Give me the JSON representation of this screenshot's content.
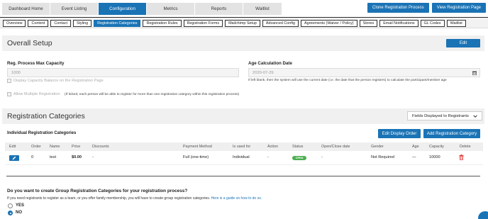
{
  "main_tabs": [
    "Dashboard Home",
    "Event Listing",
    "Configuration",
    "Metrics",
    "Reports",
    "Waitlist"
  ],
  "top_actions": {
    "clone": "Clone Registration Process",
    "view": "View Registration Page"
  },
  "sub_tabs": [
    "Overview",
    "Content",
    "Contact",
    "Styling",
    "Registration Categories",
    "Registration Rules",
    "Registration Forms",
    "Mailchimp Setup",
    "Advanced Config",
    "Agreements (Waiver / Policy)",
    "Stores",
    "Email Notifications",
    "GL Codes",
    "Waitlist"
  ],
  "overall_setup": {
    "title": "Overall Setup",
    "edit_label": "Edit",
    "max_capacity_label": "Reg. Process Max Capacity",
    "max_capacity_value": "1000",
    "display_capacity_label": "Display Capacity Balance on the Registration Page",
    "allow_multiple_label": "Allow Multiple Registration",
    "allow_multiple_note": "(If ticked, each person will be able to register for more than one registration category within this registration process)",
    "age_calc_label": "Age Calculation Date",
    "age_calc_value": "2020-07-29",
    "age_calc_note": "If left blank, then the system will use the current date (i.e. the date that the person registers) to calculate the participant/member age"
  },
  "registration_categories": {
    "title": "Registration Categories",
    "filter_label": "Fields Displayed to Registrants",
    "individual_title": "Individual Registration Categories",
    "edit_display_order": "Edit Display Order",
    "add_category": "Add Registration Category",
    "columns": [
      "Edit",
      "Order",
      "Name",
      "Price",
      "Discounts",
      "Payment Method",
      "Is used for",
      "Action",
      "Status",
      "Open/Close date",
      "Gender",
      "Age",
      "Capacity",
      "Delete"
    ],
    "rows": [
      {
        "order": "0",
        "name": "test",
        "price": "$0.00",
        "discounts": "-",
        "payment_method": "Full (one-time)",
        "used_for": "Individual",
        "action": "-",
        "status": "OPEN",
        "open_close": "-",
        "gender": "Not Required",
        "age": "—",
        "capacity": "10000"
      }
    ]
  },
  "group_section": {
    "question": "Do you want to create Group Registration Categories for your registration process?",
    "help_text": "If you need registrants to register as a team, or you offer family membership, you will have to create group registration categories.",
    "guide_link": "Here is a guide on how to do so.",
    "yes_label": "YES",
    "no_label": "NO",
    "selected": "NO"
  },
  "colors": {
    "accent": "#1a73b5",
    "status_open": "#4caf50",
    "delete": "#e53935"
  },
  "icons": {
    "edit": "pencil-icon",
    "calendar": "calendar-icon",
    "delete": "trash-icon",
    "dropdown": "chevron-down-icon"
  }
}
